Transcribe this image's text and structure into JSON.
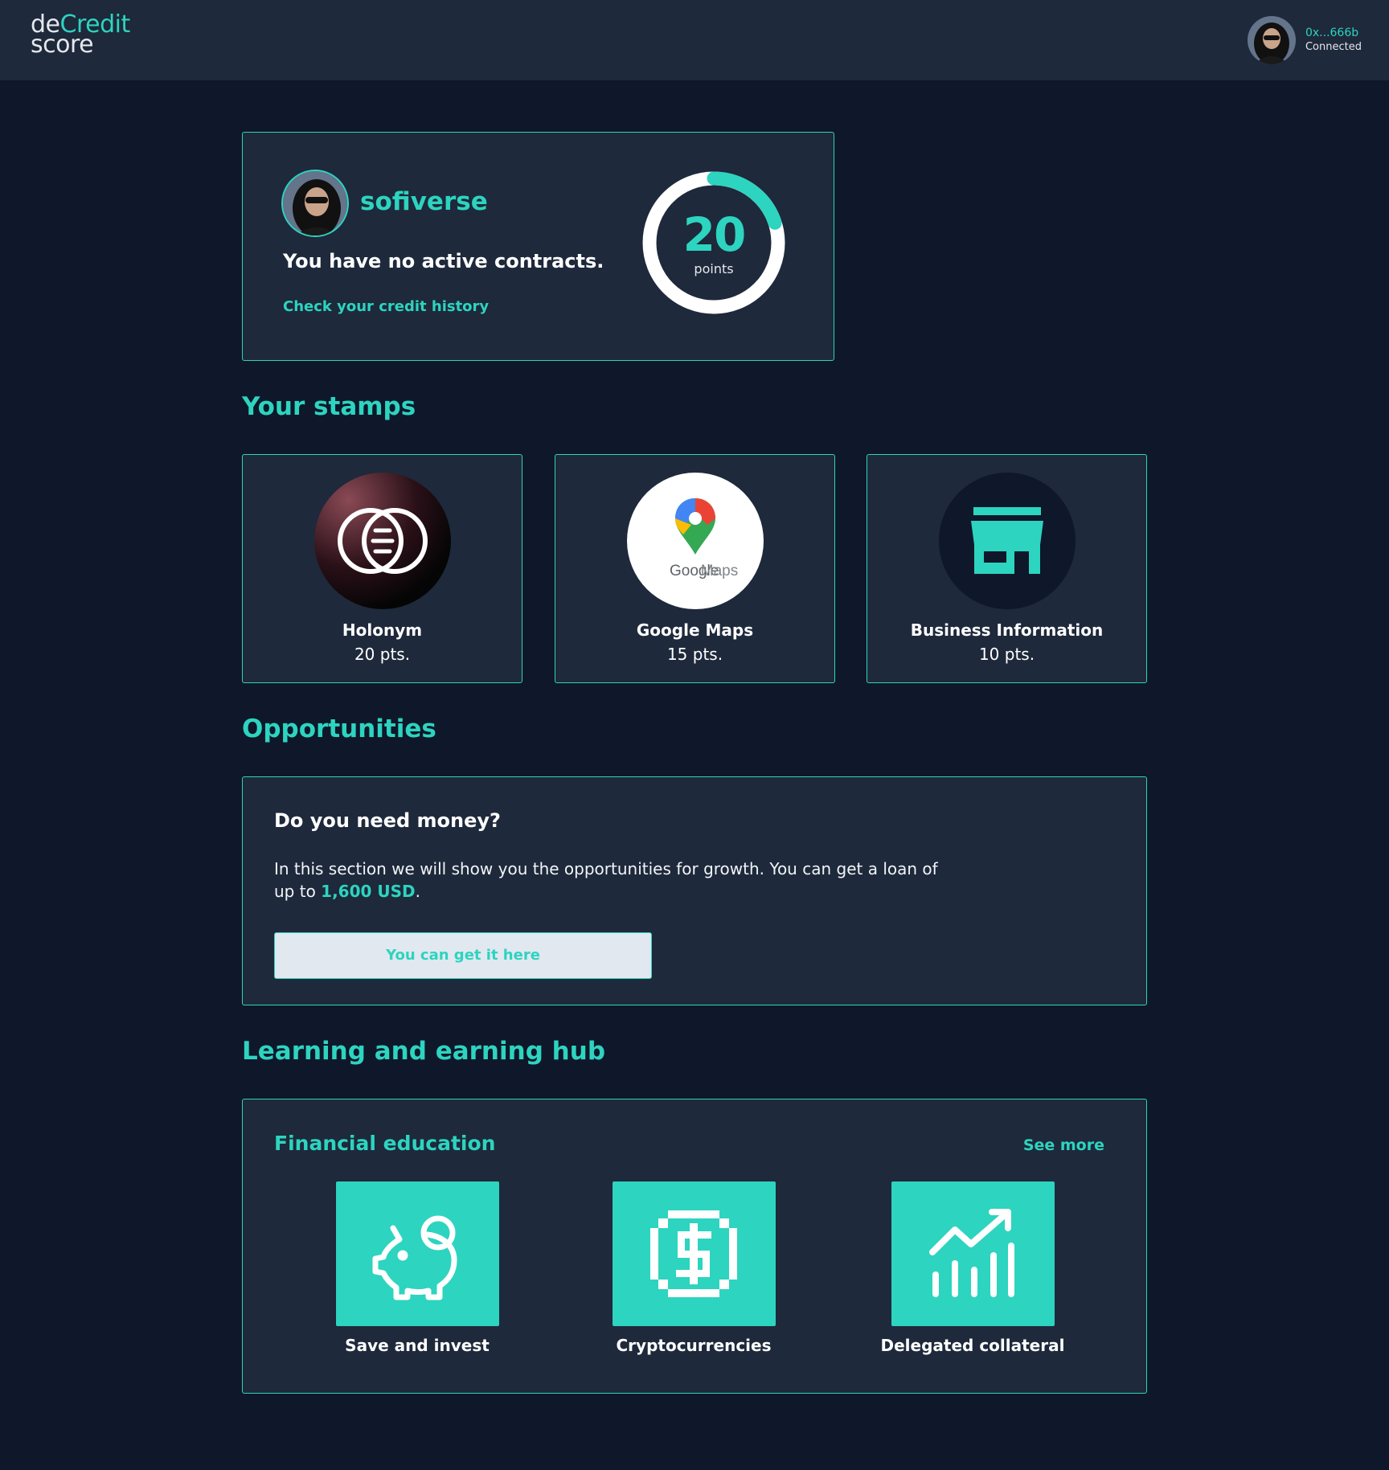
{
  "header": {
    "logo_de": "de",
    "logo_credit": "Credit",
    "logo_score": "score",
    "wallet_address": "0x...666b",
    "wallet_status": "Connected"
  },
  "profile": {
    "username": "sofiverse",
    "contracts_message": "You have no active contracts.",
    "history_link": "Check your credit history",
    "score": "20",
    "score_label": "points",
    "score_fraction": 0.2
  },
  "stamps": {
    "title": "Your stamps",
    "items": [
      {
        "name": "Holonym",
        "points": "20 pts.",
        "icon": "holonym-logo-icon"
      },
      {
        "name": "Google Maps",
        "points": "15 pts.",
        "icon": "google-maps-logo-icon",
        "logo_text_1": "Google",
        "logo_text_2": "Maps"
      },
      {
        "name": "Business Information",
        "points": "10 pts.",
        "icon": "store-icon"
      }
    ]
  },
  "opportunities": {
    "title": "Opportunities",
    "heading": "Do you need money?",
    "text_before": "In this section we will show you the opportunities for growth. You can get a loan of up to ",
    "amount": "1,600 USD",
    "text_after": ".",
    "button_label": "You can get it here"
  },
  "hub": {
    "title": "Learning and earning hub",
    "card_title": "Financial education",
    "see_more": "See more",
    "courses": [
      {
        "label": "Save and invest",
        "icon": "piggy-bank-icon"
      },
      {
        "label": "Cryptocurrencies",
        "icon": "dollar-coin-icon"
      },
      {
        "label": "Delegated collateral",
        "icon": "growth-chart-icon"
      }
    ]
  },
  "colors": {
    "background": "#0f172a",
    "card": "#1e293b",
    "accent": "#2dd4bf"
  }
}
